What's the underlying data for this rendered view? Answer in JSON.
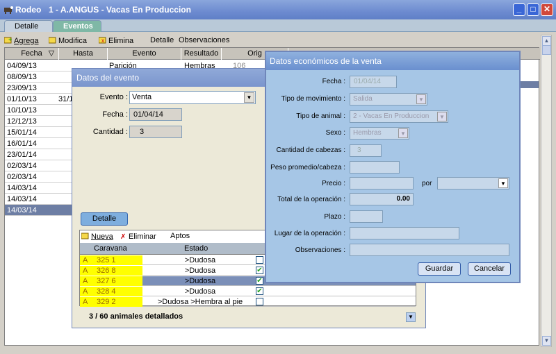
{
  "window": {
    "app": "Rodeo",
    "title": "1 - A.ANGUS - Vacas En Produccion"
  },
  "tabs": [
    "Detalle",
    "Eventos"
  ],
  "toolbar": {
    "agrega": "Agrega",
    "modifica": "Modifica",
    "elimina": "Elimina",
    "detalle": "Detalle",
    "observaciones": "Observaciones"
  },
  "grid": {
    "headers": [
      "Fecha",
      "Hasta",
      "Evento",
      "Resultado",
      "Orig"
    ],
    "dates": [
      "04/09/13",
      "08/09/13",
      "23/09/13",
      "01/10/13",
      "10/10/13",
      "12/12/13",
      "15/01/14",
      "16/01/14",
      "23/01/14",
      "02/03/14",
      "02/03/14",
      "14/03/14",
      "14/03/14",
      "14/03/14"
    ],
    "hasta_partial": "31/1",
    "first_event": "Parición",
    "first_result": "Hembras",
    "first_orig": "106"
  },
  "evento_dialog": {
    "title": "Datos del evento",
    "evento_label": "Evento :",
    "evento_value": "Venta",
    "fecha_label": "Fecha :",
    "fecha_value": "01/04/14",
    "cantidad_label": "Cantidad :",
    "cantidad_value": "3",
    "detalle_button": "Detalle",
    "sub_toolbar": {
      "nueva": "Nueva",
      "eliminar": "Eliminar",
      "aptos": "Aptos"
    },
    "sub_headers": [
      "Caravana",
      "Estado"
    ],
    "animals": [
      {
        "prefix": "A",
        "caravana": "325 1",
        "estado": ">Dudosa",
        "checked": false
      },
      {
        "prefix": "A",
        "caravana": "326 8",
        "estado": ">Dudosa",
        "checked": true
      },
      {
        "prefix": "A",
        "caravana": "327 6",
        "estado": ">Dudosa",
        "checked": true
      },
      {
        "prefix": "A",
        "caravana": "328 4",
        "estado": ">Dudosa",
        "checked": true
      },
      {
        "prefix": "A",
        "caravana": "329 2",
        "estado": ">Dudosa >Hembra al pie",
        "checked": false
      }
    ],
    "status": "3 /   60 animales detallados"
  },
  "venta_dialog": {
    "title": "Datos económicos de la venta",
    "labels": {
      "fecha": "Fecha :",
      "tipo_mov": "Tipo de movimiento :",
      "tipo_animal": "Tipo de animal :",
      "sexo": "Sexo :",
      "cabezas": "Cantidad de cabezas :",
      "peso": "Peso promedio/cabeza :",
      "precio": "Precio :",
      "por": "por",
      "total": "Total de la operación :",
      "plazo": "Plazo :",
      "lugar": "Lugar de la operación :",
      "obs": "Observaciones :"
    },
    "values": {
      "fecha": "01/04/14",
      "tipo_mov": "Salida",
      "tipo_animal": "2 - Vacas En Produccion",
      "sexo": "Hembras",
      "cabezas": "3",
      "total": "0.00"
    },
    "guardar": "Guardar",
    "cancelar": "Cancelar"
  }
}
